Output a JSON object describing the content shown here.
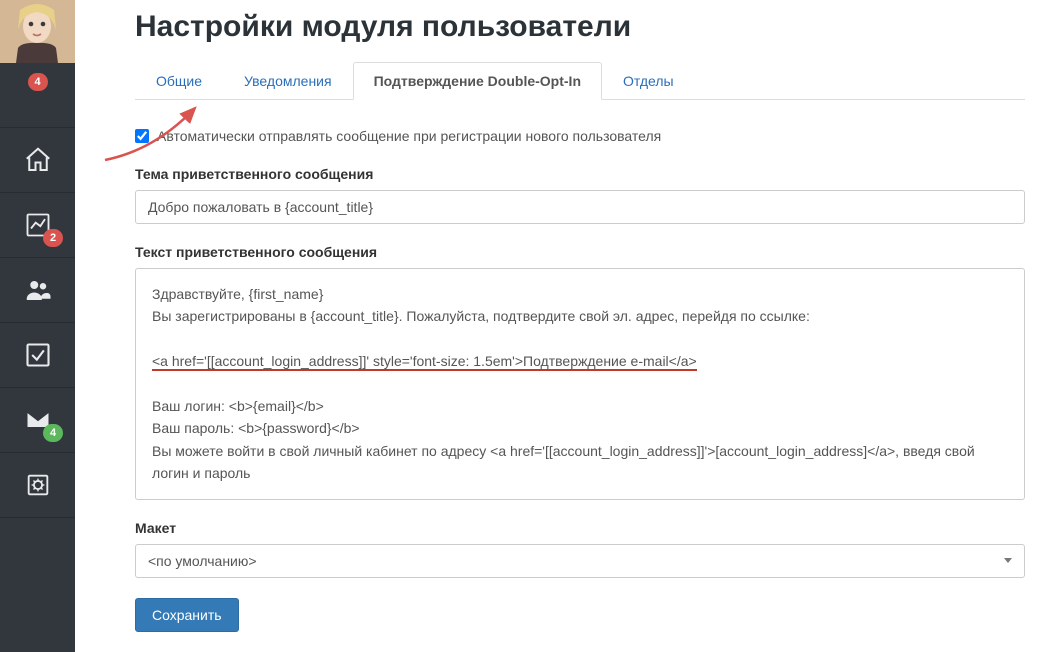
{
  "sidebar": {
    "badge_top": "4",
    "badge_chart": "2",
    "badge_mail": "4"
  },
  "page": {
    "title": "Настройки модуля пользователи"
  },
  "tabs": {
    "general": "Общие",
    "notifications": "Уведомления",
    "doubleoptin": "Подтверждение Double-Opt-In",
    "departments": "Отделы"
  },
  "form": {
    "checkbox_label": "Автоматически отправлять сообщение при регистрации нового пользователя",
    "subject_label": "Тема приветственного сообщения",
    "subject_value": "Добро пожаловать в {account_title}",
    "body_label": "Текст приветственного сообщения",
    "body_line1": "Здравствуйте, {first_name}",
    "body_line2": "Вы зарегистрированы в {account_title}. Пожалуйста, подтвердите свой эл. адрес, перейдя по ссылке:",
    "body_link": "<a href='[[account_login_address]]' style='font-size: 1.5em'>Подтверждение e-mail</a>",
    "body_line3": "Ваш логин: <b>{email}</b>",
    "body_line4": "Ваш пароль: <b>{password}</b>",
    "body_line5": "Вы можете войти в свой личный кабинет по адресу <a href='[[account_login_address]]'>[account_login_address]</a>, введя свой логин и пароль",
    "layout_label": "Макет",
    "layout_value": "<по умолчанию>",
    "save_button": "Сохранить"
  }
}
